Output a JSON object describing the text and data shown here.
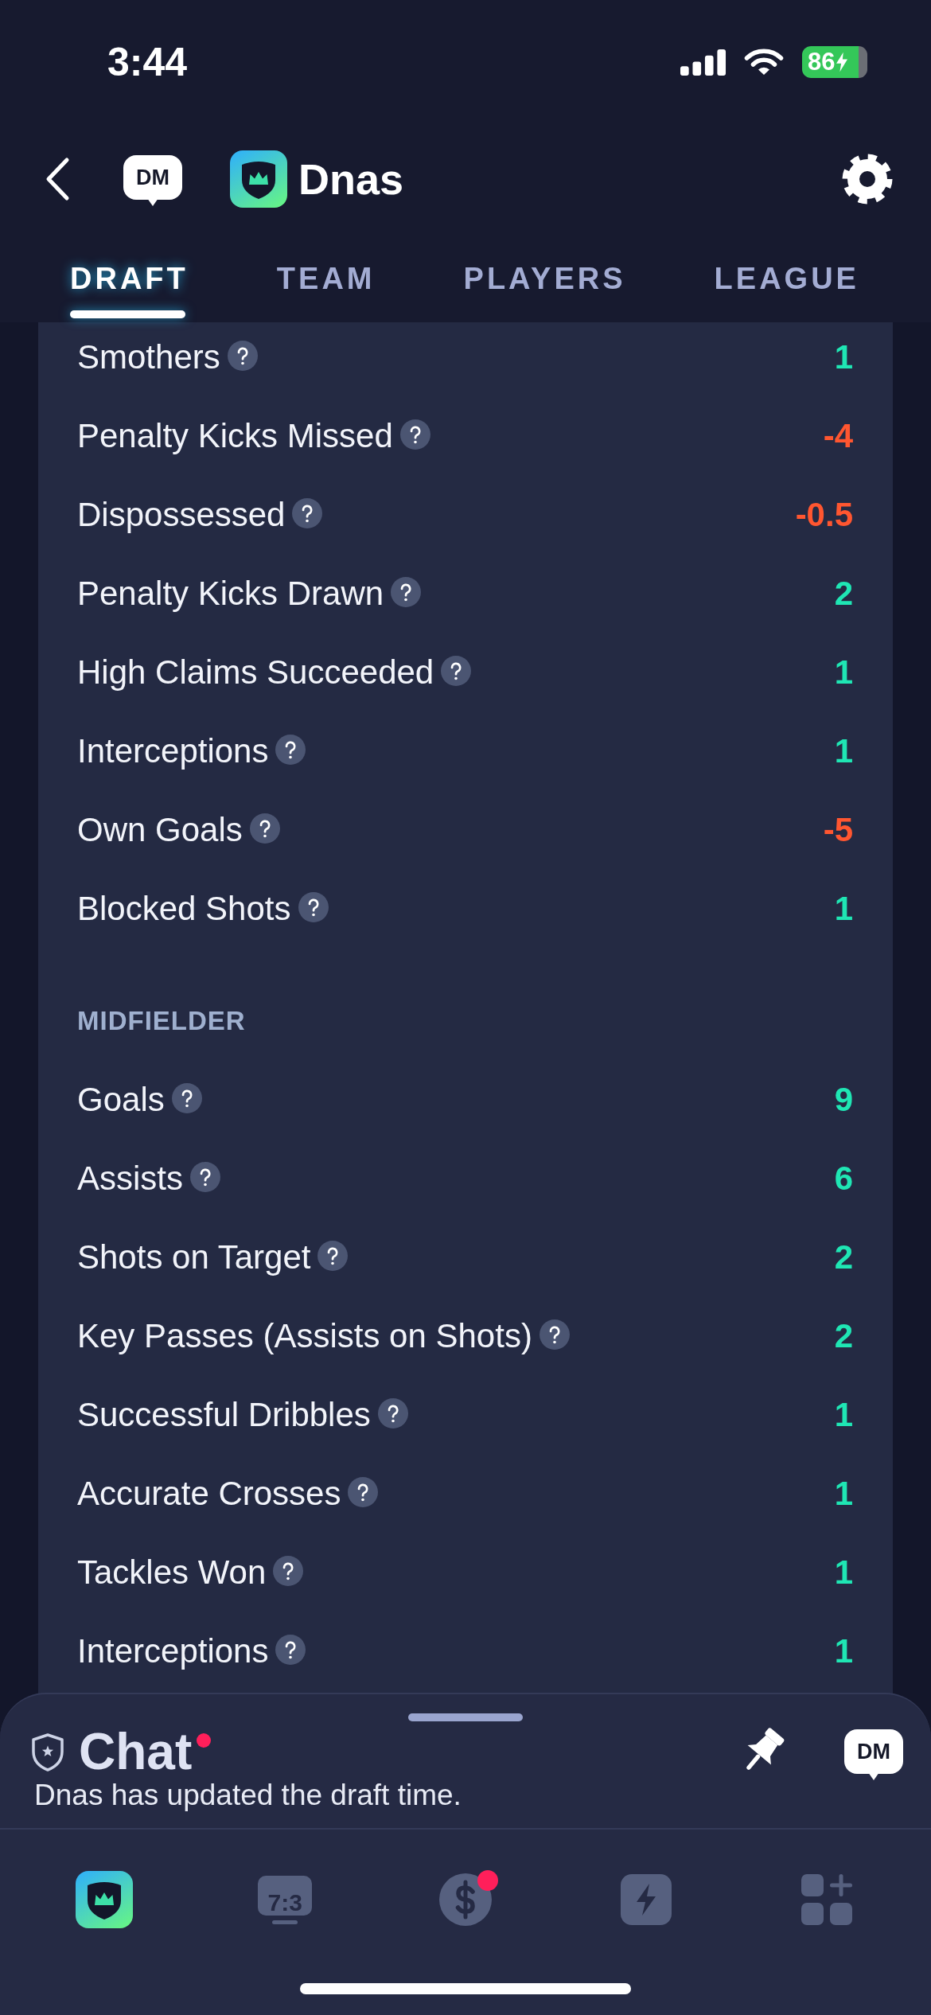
{
  "status_bar": {
    "time": "3:44",
    "battery": {
      "percent": "86",
      "charging": true
    }
  },
  "header": {
    "dm_label": "DM",
    "title": "Dnas"
  },
  "tabs": [
    {
      "label": "DRAFT",
      "selected": true
    },
    {
      "label": "TEAM",
      "selected": false
    },
    {
      "label": "PLAYERS",
      "selected": false
    },
    {
      "label": "LEAGUE",
      "selected": false
    }
  ],
  "sections": [
    {
      "rows": [
        {
          "label": "Smothers",
          "value": "1",
          "color": "#1fe6b4"
        },
        {
          "label": "Penalty Kicks Missed",
          "value": "-4",
          "color": "#ff5630"
        },
        {
          "label": "Dispossessed",
          "value": "-0.5",
          "color": "#ff5630"
        },
        {
          "label": "Penalty Kicks Drawn",
          "value": "2",
          "color": "#1fe6b4"
        },
        {
          "label": "High Claims Succeeded",
          "value": "1",
          "color": "#1fe6b4"
        },
        {
          "label": "Interceptions",
          "value": "1",
          "color": "#1fe6b4"
        },
        {
          "label": "Own Goals",
          "value": "-5",
          "color": "#ff5630"
        },
        {
          "label": "Blocked Shots",
          "value": "1",
          "color": "#1fe6b4"
        }
      ]
    },
    {
      "heading": "MIDFIELDER",
      "rows": [
        {
          "label": "Goals",
          "value": "9",
          "color": "#1fe6b4"
        },
        {
          "label": "Assists",
          "value": "6",
          "color": "#1fe6b4"
        },
        {
          "label": "Shots on Target",
          "value": "2",
          "color": "#1fe6b4"
        },
        {
          "label": "Key Passes (Assists on Shots)",
          "value": "2",
          "color": "#1fe6b4"
        },
        {
          "label": "Successful Dribbles",
          "value": "1",
          "color": "#1fe6b4"
        },
        {
          "label": "Accurate Crosses",
          "value": "1",
          "color": "#1fe6b4"
        },
        {
          "label": "Tackles Won",
          "value": "1",
          "color": "#1fe6b4"
        },
        {
          "label": "Interceptions",
          "value": "1",
          "color": "#1fe6b4"
        }
      ]
    }
  ],
  "chat": {
    "title": "Chat",
    "unread": true,
    "message": "Dnas has updated the draft time.",
    "dm_label": "DM"
  },
  "bottom_nav": [
    {
      "kind": "league",
      "selected": true,
      "badge": false
    },
    {
      "kind": "scores",
      "label": "7:3",
      "selected": false,
      "badge": false
    },
    {
      "kind": "wallet",
      "selected": false,
      "badge": true
    },
    {
      "kind": "boost",
      "selected": false,
      "badge": false
    },
    {
      "kind": "more",
      "selected": false,
      "badge": false
    }
  ]
}
